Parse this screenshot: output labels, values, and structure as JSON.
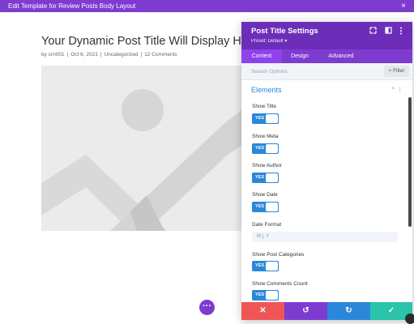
{
  "window": {
    "title": "Edit Template for Review Posts Body Layout",
    "close_glyph": "×"
  },
  "post": {
    "title": "Your Dynamic Post Title Will Display Here",
    "meta": {
      "author": "by crn001",
      "date": "Oct 6, 2021",
      "category": "Uncategorized",
      "comments": "12 Comments",
      "separator": "|"
    },
    "image_icon": "image-placeholder-icon"
  },
  "fab": {
    "glyph": "···"
  },
  "panel": {
    "title": "Post Title Settings",
    "preset": "Preset: Default ▾",
    "header_icons": [
      "expand-icon",
      "columns-icon",
      "more-icon"
    ],
    "tabs": [
      {
        "label": "Content",
        "active": true
      },
      {
        "label": "Design",
        "active": false
      },
      {
        "label": "Advanced",
        "active": false
      }
    ],
    "search": {
      "placeholder": "Search Options",
      "value": ""
    },
    "filter_label": "+ Filter",
    "section": {
      "title": "Elements",
      "caret": "⌃ ⋮"
    },
    "fields": [
      {
        "label": "Show Title",
        "type": "toggle",
        "value": "YES"
      },
      {
        "label": "Show Meta",
        "type": "toggle",
        "value": "YES"
      },
      {
        "label": "Show Author",
        "type": "toggle",
        "value": "YES"
      },
      {
        "label": "Show Date",
        "type": "toggle",
        "value": "YES"
      },
      {
        "label": "Date Format",
        "type": "text",
        "value": "M j, Y"
      },
      {
        "label": "Show Post Categories",
        "type": "toggle",
        "value": "YES"
      },
      {
        "label": "Show Comments Count",
        "type": "toggle",
        "value": "YES"
      }
    ],
    "footer": [
      {
        "name": "discard",
        "glyph": "✕",
        "color": "#ef5555"
      },
      {
        "name": "undo",
        "glyph": "↺",
        "color": "#7e3bd0"
      },
      {
        "name": "redo",
        "glyph": "↻",
        "color": "#2b87da"
      },
      {
        "name": "save",
        "glyph": "✓",
        "color": "#29c4a9"
      }
    ]
  },
  "colors": {
    "topbar": "#7e3bd0",
    "panel_header": "#6c2eb9",
    "accent_blue": "#2b87da"
  }
}
